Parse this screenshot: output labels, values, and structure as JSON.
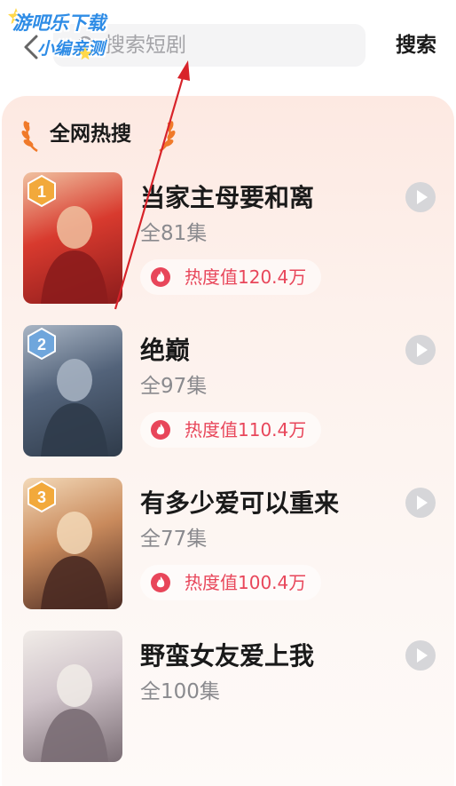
{
  "header": {
    "search_placeholder": "搜索短剧",
    "search_button": "搜索"
  },
  "watermark": {
    "line1": "游吧乐下载",
    "line2": "小编亲测"
  },
  "hot_search": {
    "title": "全网热搜",
    "items": [
      {
        "rank": "1",
        "title": "当家主母要和离",
        "episodes": "全81集",
        "heat": "热度值120.4万",
        "badge_color": "#f2a93b",
        "poster_colors": [
          "#8c1c1c",
          "#d83a2e",
          "#f0c1a0"
        ]
      },
      {
        "rank": "2",
        "title": "绝巅",
        "episodes": "全97集",
        "heat": "热度值110.4万",
        "badge_color": "#6fa6dc",
        "poster_colors": [
          "#2f3b4a",
          "#53637a",
          "#a9b5c4"
        ]
      },
      {
        "rank": "3",
        "title": "有多少爱可以重来",
        "episodes": "全77集",
        "heat": "热度值100.4万",
        "badge_color": "#f2a93b",
        "poster_colors": [
          "#4a2a22",
          "#c98a5c",
          "#f3d9b8"
        ]
      },
      {
        "rank": "",
        "title": "野蛮女友爱上我",
        "episodes": "全100集",
        "heat": "",
        "badge_color": "",
        "poster_colors": [
          "#7a6d74",
          "#cfc3c9",
          "#f1ece8"
        ]
      }
    ]
  },
  "colors": {
    "accent_red": "#e8465a",
    "annotation_arrow": "#d8232a"
  }
}
